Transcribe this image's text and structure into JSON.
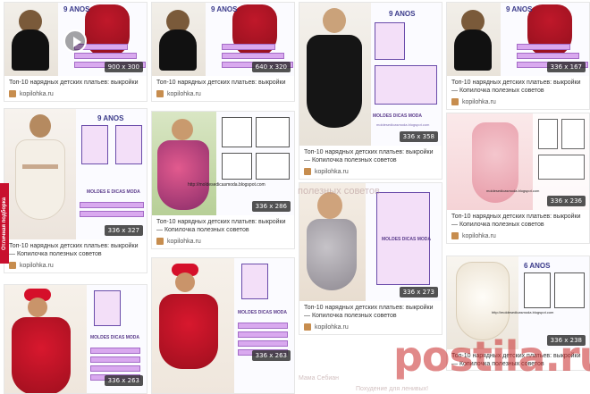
{
  "side_tab": "Отличная подборка",
  "watermark": "postila.ru",
  "source_label": "kopilohka.ru",
  "caption_short": "Топ-10 нарядных детских платьев: выкройки",
  "caption_long": "Топ-10 нарядных детских платьев: выкройки — Копилочка полезных советов",
  "pattern_titles": {
    "nine_years": "9 ANOS",
    "six_years": "6 ANOS",
    "moldes": "MOLDES DICAS MODA",
    "moldes_e": "MOLDES E DICAS MODA",
    "blog": "moldesedicasmoda.blogspot.com",
    "url": "http://moldesedicasmoda.blogspot.com"
  },
  "ghost_texts": [
    "полезных советов",
    "Мама Себиан",
    "Похудение для ленивых!"
  ],
  "colors": {
    "badge_bg": "#282828",
    "watermark": "#c82828",
    "side_tab": "#c8102e"
  },
  "cards": [
    {
      "size": "900 x 300"
    },
    {
      "size": "640 x 320"
    },
    {
      "size": "336 x 358"
    },
    {
      "size": "336 x 167"
    },
    {
      "size": "336 x 327"
    },
    {
      "size": "336 x 286"
    },
    {
      "size": "336 x 273"
    },
    {
      "size": "336 x 236"
    },
    {
      "size": "336 x 263"
    },
    {
      "size": "336 x 263"
    },
    {
      "size": "336 x 238"
    }
  ]
}
